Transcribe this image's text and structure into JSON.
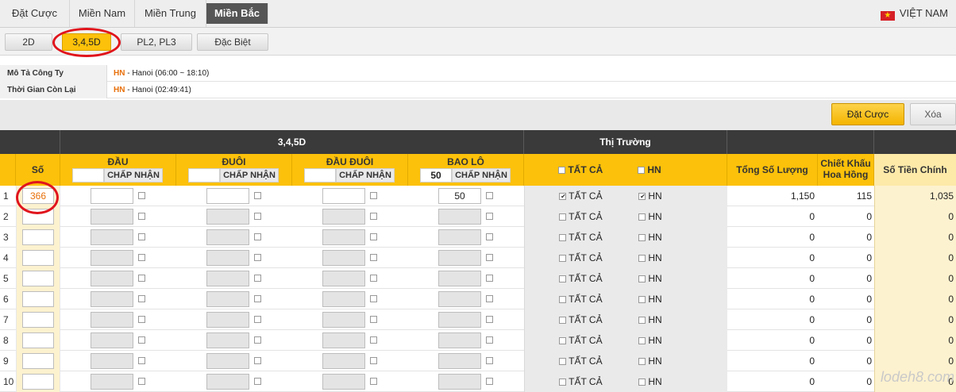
{
  "topnav": {
    "tabs": [
      "Đặt Cược",
      "Miền Nam",
      "Miền Trung",
      "Miền Bắc"
    ],
    "active_tab": "Miền Bắc",
    "language": "VIỆT NAM"
  },
  "subnav": {
    "buttons": [
      "2D",
      "3,4,5D",
      "PL2, PL3",
      "Đặc Biệt"
    ],
    "active": "3,4,5D"
  },
  "info": {
    "company_label": "Mô Tả Công Ty",
    "company_code": "HN",
    "company_value": " - Hanoi (06:00 ~ 18:10)",
    "time_label": "Thời Gian Còn Lại",
    "time_code": "HN",
    "time_value": " - Hanoi (02:49:41)"
  },
  "actions": {
    "bet_label": "Đặt Cược",
    "delete_label": "Xóa"
  },
  "table": {
    "group_header": "3,4,5D",
    "market_header": "Thị Trường",
    "so_header": "Số",
    "bet_columns": [
      {
        "label": "ĐẦU",
        "value": ""
      },
      {
        "label": "ĐUÔI",
        "value": ""
      },
      {
        "label": "ĐẦU ĐUÔI",
        "value": ""
      },
      {
        "label": "BAO LÔ",
        "value": "50"
      }
    ],
    "accept_label": "CHẤP NHẬN",
    "market_all": "TẤT CẢ",
    "market_hn": "HN",
    "total_header": "Tổng Số Lượng",
    "discount_header": "Chiết Khấu Hoa Hồng",
    "amount_header": "Số Tiền Chính",
    "rows": [
      {
        "n": "1",
        "so": "366",
        "baolo": "50",
        "all_checked": true,
        "hn_checked": true,
        "total": "1,150",
        "discount": "115",
        "amount": "1,035"
      },
      {
        "n": "2",
        "so": "",
        "baolo": "",
        "all_checked": false,
        "hn_checked": false,
        "total": "0",
        "discount": "0",
        "amount": "0"
      },
      {
        "n": "3",
        "so": "",
        "baolo": "",
        "all_checked": false,
        "hn_checked": false,
        "total": "0",
        "discount": "0",
        "amount": "0"
      },
      {
        "n": "4",
        "so": "",
        "baolo": "",
        "all_checked": false,
        "hn_checked": false,
        "total": "0",
        "discount": "0",
        "amount": "0"
      },
      {
        "n": "5",
        "so": "",
        "baolo": "",
        "all_checked": false,
        "hn_checked": false,
        "total": "0",
        "discount": "0",
        "amount": "0"
      },
      {
        "n": "6",
        "so": "",
        "baolo": "",
        "all_checked": false,
        "hn_checked": false,
        "total": "0",
        "discount": "0",
        "amount": "0"
      },
      {
        "n": "7",
        "so": "",
        "baolo": "",
        "all_checked": false,
        "hn_checked": false,
        "total": "0",
        "discount": "0",
        "amount": "0"
      },
      {
        "n": "8",
        "so": "",
        "baolo": "",
        "all_checked": false,
        "hn_checked": false,
        "total": "0",
        "discount": "0",
        "amount": "0"
      },
      {
        "n": "9",
        "so": "",
        "baolo": "",
        "all_checked": false,
        "hn_checked": false,
        "total": "0",
        "discount": "0",
        "amount": "0"
      },
      {
        "n": "10",
        "so": "",
        "baolo": "",
        "all_checked": false,
        "hn_checked": false,
        "total": "0",
        "discount": "0",
        "amount": "0"
      }
    ]
  },
  "watermark": "lodeh8.com",
  "colors": {
    "accent": "#fcc10a",
    "highlight_circle": "#e0141c",
    "code_orange": "#e8700a"
  }
}
